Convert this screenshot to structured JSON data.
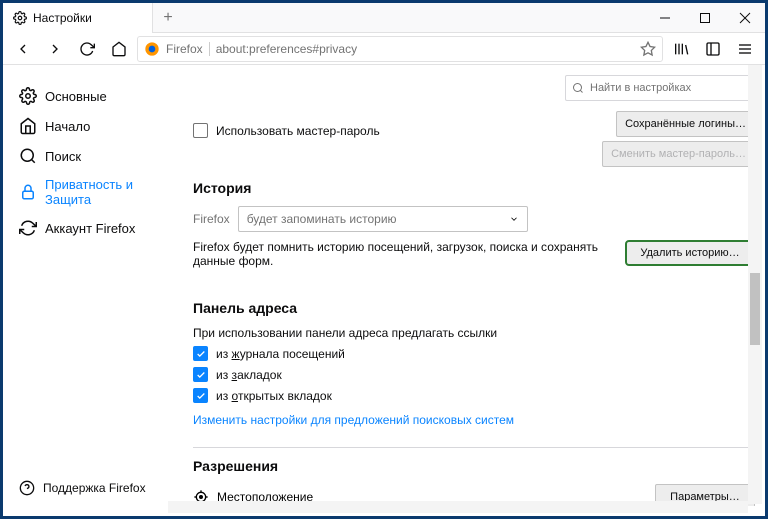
{
  "tab": {
    "title": "Настройки"
  },
  "addressbar": {
    "brand": "Firefox",
    "value": "about:preferences#privacy"
  },
  "search": {
    "placeholder": "Найти в настройках",
    "icon": "search-icon"
  },
  "sidebar": {
    "items": [
      {
        "label": "Основные",
        "icon": "gear-icon"
      },
      {
        "label": "Начало",
        "icon": "home-icon"
      },
      {
        "label": "Поиск",
        "icon": "search-icon"
      },
      {
        "label": "Приватность и Защита",
        "icon": "lock-icon"
      },
      {
        "label": "Аккаунт Firefox",
        "icon": "sync-icon"
      }
    ],
    "support": "Поддержка Firefox"
  },
  "buttons": {
    "saved_logins": "Сохранённые логины…",
    "change_master": "Сменить мастер-пароль…",
    "delete_history": "Удалить историю…",
    "location_prefs": "Параметры…"
  },
  "passwords": {
    "master_checkbox": "Использовать мастер-пароль"
  },
  "history": {
    "title": "История",
    "firefox_label": "Firefox",
    "select_value": "будет запоминать историю",
    "desc": "Firefox будет помнить историю посещений, загрузок, поиска и сохранять данные форм."
  },
  "addressbar_panel": {
    "title": "Панель адреса",
    "desc": "При использовании панели адреса предлагать ссылки",
    "cb1_prefix": "из ",
    "cb1_u": "ж",
    "cb1_rest": "урнала посещений",
    "cb2_prefix": "из ",
    "cb2_u": "з",
    "cb2_rest": "акладок",
    "cb3_prefix": "из ",
    "cb3_u": "о",
    "cb3_rest": "ткрытых вкладок",
    "link": "Изменить настройки для предложений поисковых систем"
  },
  "permissions": {
    "title": "Разрешения",
    "location": "Местоположение"
  }
}
